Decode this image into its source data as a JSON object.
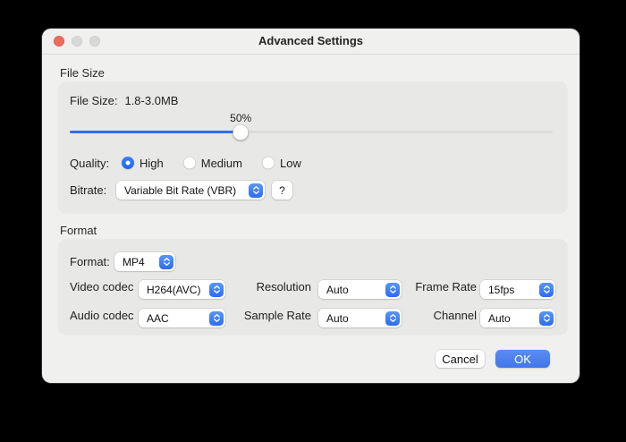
{
  "window": {
    "title": "Advanced Settings"
  },
  "file_size_section": {
    "group_label": "File Size",
    "file_size_label": "File Size:",
    "file_size_value": "1.8-3.0MB",
    "slider": {
      "value_label": "50%"
    },
    "quality": {
      "label": "Quality:",
      "options": [
        "High",
        "Medium",
        "Low"
      ],
      "selected": "High"
    },
    "bitrate": {
      "label": "Bitrate:",
      "value": "Variable Bit Rate (VBR)",
      "help_label": "?"
    }
  },
  "format_section": {
    "group_label": "Format",
    "format": {
      "label": "Format:",
      "value": "MP4"
    },
    "fields": [
      {
        "label": "Video codec",
        "value": "H264(AVC)"
      },
      {
        "label": "Resolution",
        "value": "Auto"
      },
      {
        "label": "Frame Rate",
        "value": "15fps"
      },
      {
        "label": "Audio codec",
        "value": "AAC"
      },
      {
        "label": "Sample Rate",
        "value": "Auto"
      },
      {
        "label": "Channel",
        "value": "Auto"
      }
    ]
  },
  "footer": {
    "cancel_label": "Cancel",
    "ok_label": "OK"
  },
  "colors": {
    "accent_blue": "#2f6ff2",
    "ok_button_blue": "#4276e9",
    "close_red": "#ec6a5e",
    "window_bg": "#f0f0ee",
    "panel_bg": "#e8e8e6"
  }
}
